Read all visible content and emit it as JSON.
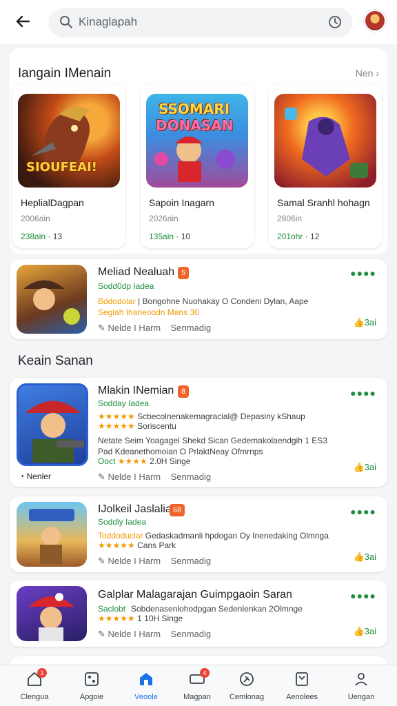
{
  "header": {
    "search_query": "Kinaglapah"
  },
  "featured": {
    "title": "Iangain IMenain",
    "more_label": "Nen",
    "cards": [
      {
        "title": "HeplialDagpan",
        "subtitle": "2006ain",
        "rating": "238ain",
        "downloads": "· 13",
        "art_text": "SIOUFEAI!"
      },
      {
        "title": "Sapoin Inagarn",
        "subtitle": "2026ain",
        "rating": "135ain",
        "downloads": "· 10",
        "art_text_1": "SSOMARI",
        "art_text_2": "DONASAN"
      },
      {
        "title": "Samal Sranhl hohagn",
        "subtitle": "2806in",
        "rating": "201ohr",
        "downloads": "· 12"
      }
    ]
  },
  "section2": {
    "title": "Keain Sanan"
  },
  "apps": [
    {
      "name": "Meliad Nealuah",
      "badge": "5",
      "developer": "Sodd0dp Iadea",
      "line1_hl": "Bddodolar",
      "line1": "| Bongohne Nuohakay O Condeni Dylan, Aape",
      "line2_hl": "Seglah Ihaneoodn Mans",
      "line2": "30",
      "footer1": "Nelde I Harm",
      "footer2": "Senmadig",
      "action": "3ai"
    },
    {
      "name": "Mlakin INemian",
      "badge": "8",
      "developer": "Sodday Iadea",
      "stars": "★★★★★",
      "line1": "Scbecolnenakemagracial@ Depasiny kShaup",
      "stars2": "★★★★★",
      "line2": "Soriscentu",
      "line3": "Netate Seim Yoagagel Shekd Sican Gedemakolaendgih 1 ES3",
      "line4": "Pad Kdeanethomoian O PrlaktNeay Ofmrnps",
      "line5_hl": "Ooct",
      "line5": "2.0H Singe",
      "left_tag": "Nenler",
      "footer1": "Nelde I Harm",
      "footer2": "Senmadig",
      "action": "3ai"
    },
    {
      "name": "IJolkeil Jaslalia",
      "badge": "68",
      "developer": "Soddly Iadea",
      "line1_hl": "Toddoduclar",
      "line1": "Gedaskadmanli hpdogan Oy Inenedaking Olmnga",
      "stars": "★★★★★",
      "line2": "Cans Park",
      "footer1": "Nelde I Harm",
      "footer2": "Senmadig",
      "action": "3ai"
    },
    {
      "name": "Galplar Malagarajan Guimpgaoin Saran",
      "developer": "Saclobt",
      "line1": "Sobdenasenlohodpgan Sedenlenkan 2Olmnge",
      "stars": "★★★★★",
      "line2": "1 10H Singe",
      "footer1": "Nelde I Harm",
      "footer2": "Senmadig",
      "action": "3ai"
    }
  ],
  "nav": [
    {
      "label": "Clengua",
      "icon": "home-icon",
      "badge": "1"
    },
    {
      "label": "Apgoie",
      "icon": "apps-icon"
    },
    {
      "label": "Veoole",
      "icon": "store-icon",
      "active": true
    },
    {
      "label": "Magpan",
      "icon": "ticket-icon",
      "badge": "4"
    },
    {
      "label": "Cemlonag",
      "icon": "compass-icon"
    },
    {
      "label": "Aenolees",
      "icon": "library-icon"
    },
    {
      "label": "Uengan",
      "icon": "profile-icon"
    }
  ]
}
